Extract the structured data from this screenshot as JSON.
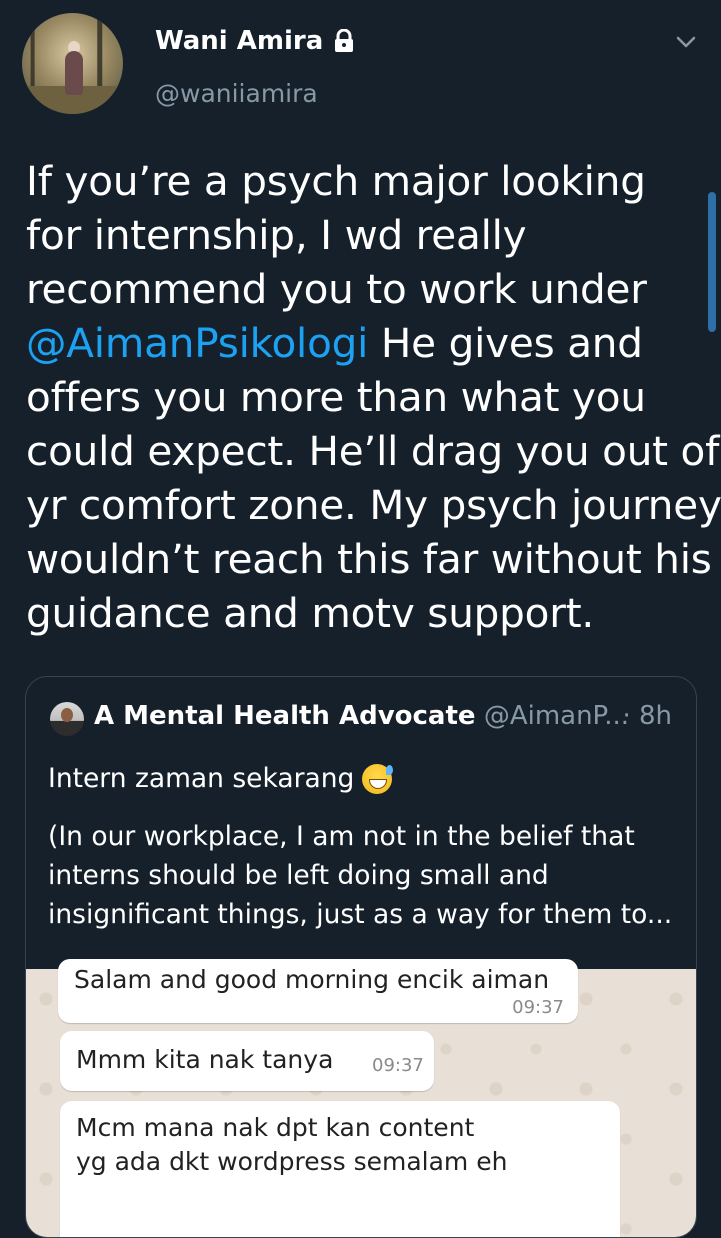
{
  "author": {
    "name": "Wani Amira",
    "handle": "@waniiamira",
    "icons": {
      "lock": "lock-icon",
      "menu": "chevron-down-icon"
    }
  },
  "tweet": {
    "lines": [
      "If you’re a psych major looking",
      "for internship, I wd really",
      "recommend you to work under",
      {
        "mention": "@AimanPsikologi",
        "rest": " He gives and"
      },
      "offers you more than what you",
      "could expect. He’ll drag you out of",
      "yr comfort zone. My psych journey",
      "wouldn’t reach this far without his",
      "guidance and motv support."
    ]
  },
  "quote": {
    "name": "A Mental Health Advocate",
    "handle": "@AimanP...",
    "time": "· 8h",
    "first_line": "Intern zaman sekarang",
    "emoji": "grinning-sweat-emoji",
    "body_lines": [
      "(In our workplace, I am not in the belief that",
      "interns should be left doing small and",
      "insignificant things,  just as a way for them to..."
    ],
    "chat": [
      {
        "text": "Salam and good morning encik aiman",
        "time": "09:37"
      },
      {
        "text": "Mmm kita nak tanya",
        "time": "09:37"
      },
      {
        "text_lines": [
          "Mcm mana nak dpt kan content",
          "yg ada dkt wordpress semalam eh"
        ]
      }
    ]
  },
  "colors": {
    "background": "#15202b",
    "text": "#ffffff",
    "secondary": "#8899a6",
    "link": "#1da1f2",
    "border": "#38444d"
  }
}
